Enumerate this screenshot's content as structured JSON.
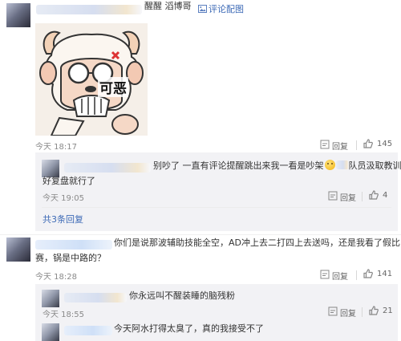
{
  "comment1": {
    "author_suffix": "醒醒 滔博哥",
    "reply_pic_label": "评论配图",
    "sticker_text": "可恶",
    "time": "今天 18:17",
    "reply_label": "回复",
    "like_count": "145"
  },
  "reply1": {
    "text_line1": "别吵了 一直有评论提醒跳出来我一看是吵架",
    "text_line1_tail": "队员汲取教训好",
    "text_line2": "好复盘就行了",
    "time": "今天 19:05",
    "reply_label": "回复",
    "like_count": "4",
    "more_replies": "共3条回复"
  },
  "comment2": {
    "text_line1": "你们是说那波辅助技能全空，AD冲上去二打四上去送吗，还是我看了假比",
    "text_line2": "赛，锅是中路的？",
    "time": "今天 18:28",
    "reply_label": "回复",
    "like_count": "141"
  },
  "reply2": {
    "text": "你永远叫不醒装睡的脑残粉",
    "time": "今天 18:55",
    "reply_label": "回复",
    "like_count": "21"
  },
  "reply3": {
    "text": "今天阿水打得太臭了，真的我接受不了"
  },
  "colors": {
    "accent_orange": "#eb7350",
    "link_blue": "#3d6ab6",
    "reply_bg": "#f2f2f5"
  }
}
